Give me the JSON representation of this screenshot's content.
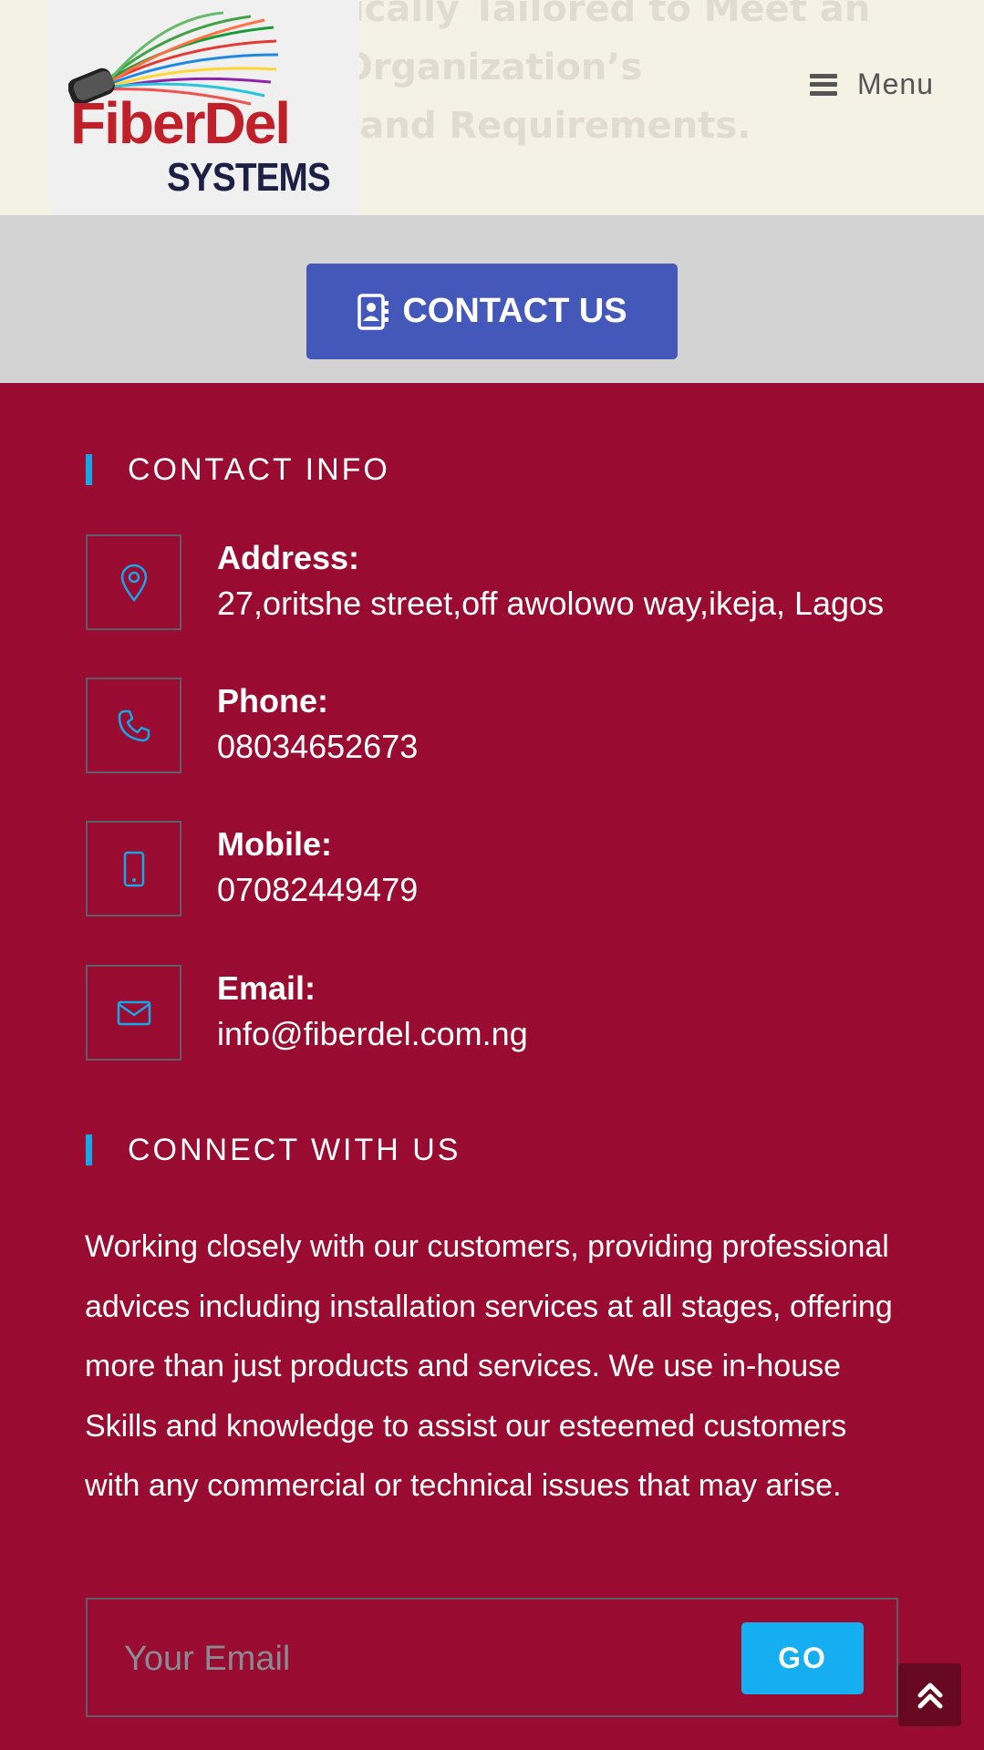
{
  "header": {
    "hero_lines": [
      "Are Strategically Tailored to Meet an",
      "Organization’s",
      "Goals and Requirements."
    ],
    "logo": {
      "brand": "FiberDel",
      "sub": "SYSTEMS"
    },
    "menu_label": "Menu",
    "menu_icon": "hamburger-icon"
  },
  "cta": {
    "label": "CONTACT US",
    "icon": "address-book-icon",
    "color": "#4358b8"
  },
  "footer": {
    "background": "#990b30",
    "accent": "#17a6e8",
    "contact_title": "CONTACT INFO",
    "contact_items": [
      {
        "label": "Address:",
        "value": "27,oritshe street,off awolowo way,ikeja, Lagos",
        "icon": "map-pin-icon"
      },
      {
        "label": "Phone:",
        "value": "08034652673",
        "icon": "phone-icon"
      },
      {
        "label": "Mobile:",
        "value": "07082449479",
        "icon": "mobile-icon"
      },
      {
        "label": "Email:",
        "value": "info@fiberdel.com.ng",
        "icon": "envelope-icon"
      }
    ],
    "connect_title": "CONNECT WITH US",
    "connect_text": "Working closely with our customers, providing professional advices including installation services at all stages, offering more than just products and services. We use in-house Skills and knowledge to assist our esteemed customers with any commercial or technical issues that may arise.",
    "newsletter": {
      "placeholder": "Your Email",
      "button_label": "GO"
    }
  },
  "scroll_top": {
    "icon": "double-chevron-up-icon"
  }
}
